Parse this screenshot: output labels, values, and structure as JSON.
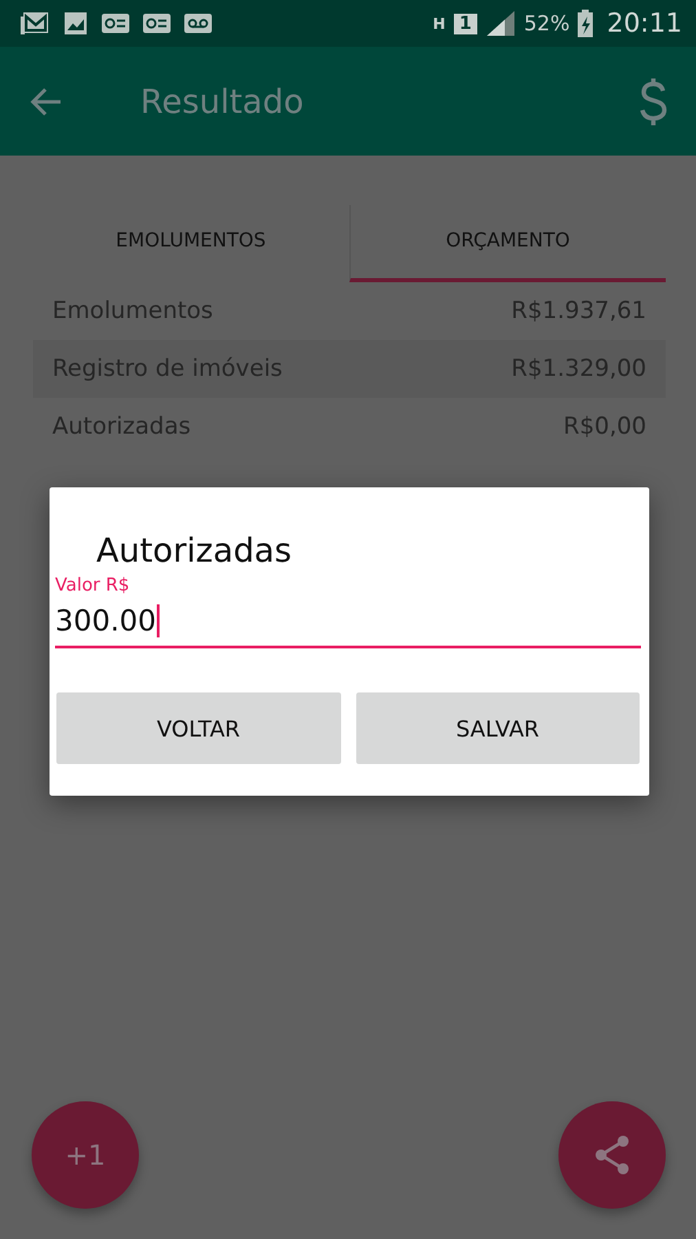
{
  "status_bar": {
    "network_type": "H",
    "sim": "1",
    "battery": "52%",
    "time": "20:11"
  },
  "app_bar": {
    "title": "Resultado"
  },
  "tabs": [
    {
      "label": "EMOLUMENTOS",
      "selected": false
    },
    {
      "label": "ORÇAMENTO",
      "selected": true
    }
  ],
  "rows": [
    {
      "label": "Emolumentos",
      "value": "R$1.937,61"
    },
    {
      "label": "Registro de imóveis",
      "value": "R$1.329,00"
    },
    {
      "label": "Autorizadas",
      "value": "R$0,00"
    }
  ],
  "dialog": {
    "title": "Autorizadas",
    "field_label": "Valor R$",
    "value": "300.00",
    "buttons": [
      "VOLTAR",
      "SALVAR"
    ]
  },
  "fab_left": {
    "label": "+1"
  }
}
